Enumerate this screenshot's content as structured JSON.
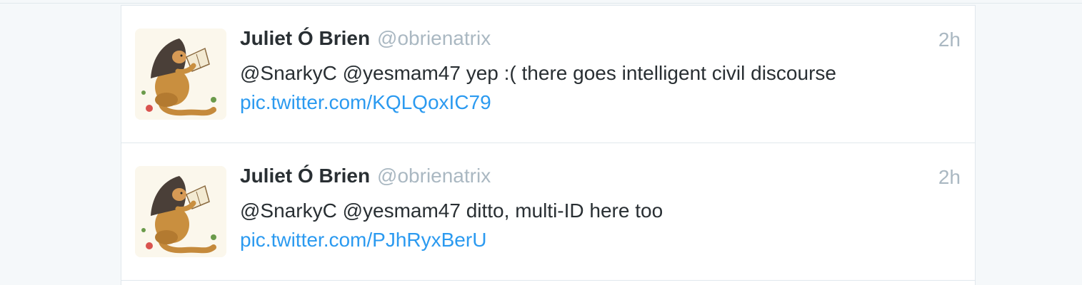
{
  "timeline": {
    "tweets": [
      {
        "fullname": "Juliet Ó Brien",
        "username": "@obrienatrix",
        "time": "2h",
        "text": "@SnarkyC @yesmam47 yep :( there goes intelligent civil discourse",
        "link": "pic.twitter.com/KQLQoxIC79"
      },
      {
        "fullname": "Juliet Ó Brien",
        "username": "@obrienatrix",
        "time": "2h",
        "text": "@SnarkyC @yesmam47 ditto, multi-ID here too",
        "link": "pic.twitter.com/PJhRyxBerU"
      }
    ]
  },
  "colors": {
    "background": "#f5f8fa",
    "card": "#ffffff",
    "divider": "#e1e8ed",
    "name": "#292f33",
    "muted": "#aab8c2",
    "link": "#2b9af0"
  }
}
